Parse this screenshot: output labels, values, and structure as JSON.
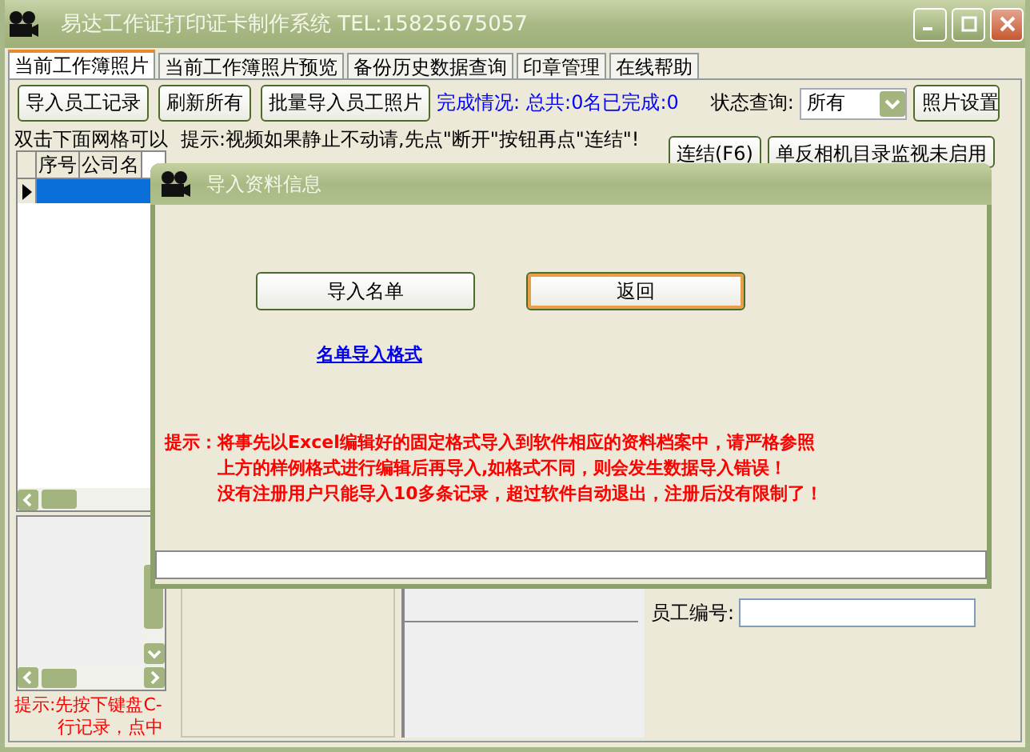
{
  "window": {
    "title": "易达工作证打印证卡制作系统 TEL:15825675057"
  },
  "tabs": [
    {
      "label": "当前工作簿照片",
      "selected": true
    },
    {
      "label": "当前工作簿照片预览",
      "selected": false
    },
    {
      "label": "备份历史数据查询",
      "selected": false
    },
    {
      "label": "印章管理",
      "selected": false
    },
    {
      "label": "在线帮助",
      "selected": false
    }
  ],
  "toolbar": {
    "buttons": [
      "导入员工记录",
      "刷新所有",
      "批量导入员工照片"
    ],
    "progress_label": "完成情况:",
    "progress_value": "总共:0名已完成:0",
    "status_label": "状态查询:",
    "status_value": "所有",
    "photo_button": "照片设置"
  },
  "grid": {
    "group_label": "双击下面网格可以",
    "columns": [
      "序号",
      "公司名"
    ],
    "rows": [
      {
        "selected": true
      }
    ]
  },
  "video_hint": "提示:视频如果静止不动请,先点\"断开\"按钮再点\"连结\"!",
  "camera_buttons": [
    "连结(F6)",
    "单反相机目录监视未启用"
  ],
  "employee_id": {
    "label": "员工编号:"
  },
  "left_hint": [
    "提示:先按下键盘C-",
    "行记录，点中"
  ],
  "dialog": {
    "title": "导入资料信息",
    "buttons": [
      {
        "label": "导入名单",
        "focused": false
      },
      {
        "label": "返回",
        "focused": true
      }
    ],
    "link": "名单导入格式",
    "notice": [
      "提示：将事先以Excel编辑好的固定格式导入到软件相应的资料档案中，请严格参照",
      "上方的样例格式进行编辑后再导入,如格式不同，则会发生数据导入错误！",
      "没有注册用户只能导入10多条记录，超过软件自动退出，注册后没有限制了！"
    ]
  }
}
